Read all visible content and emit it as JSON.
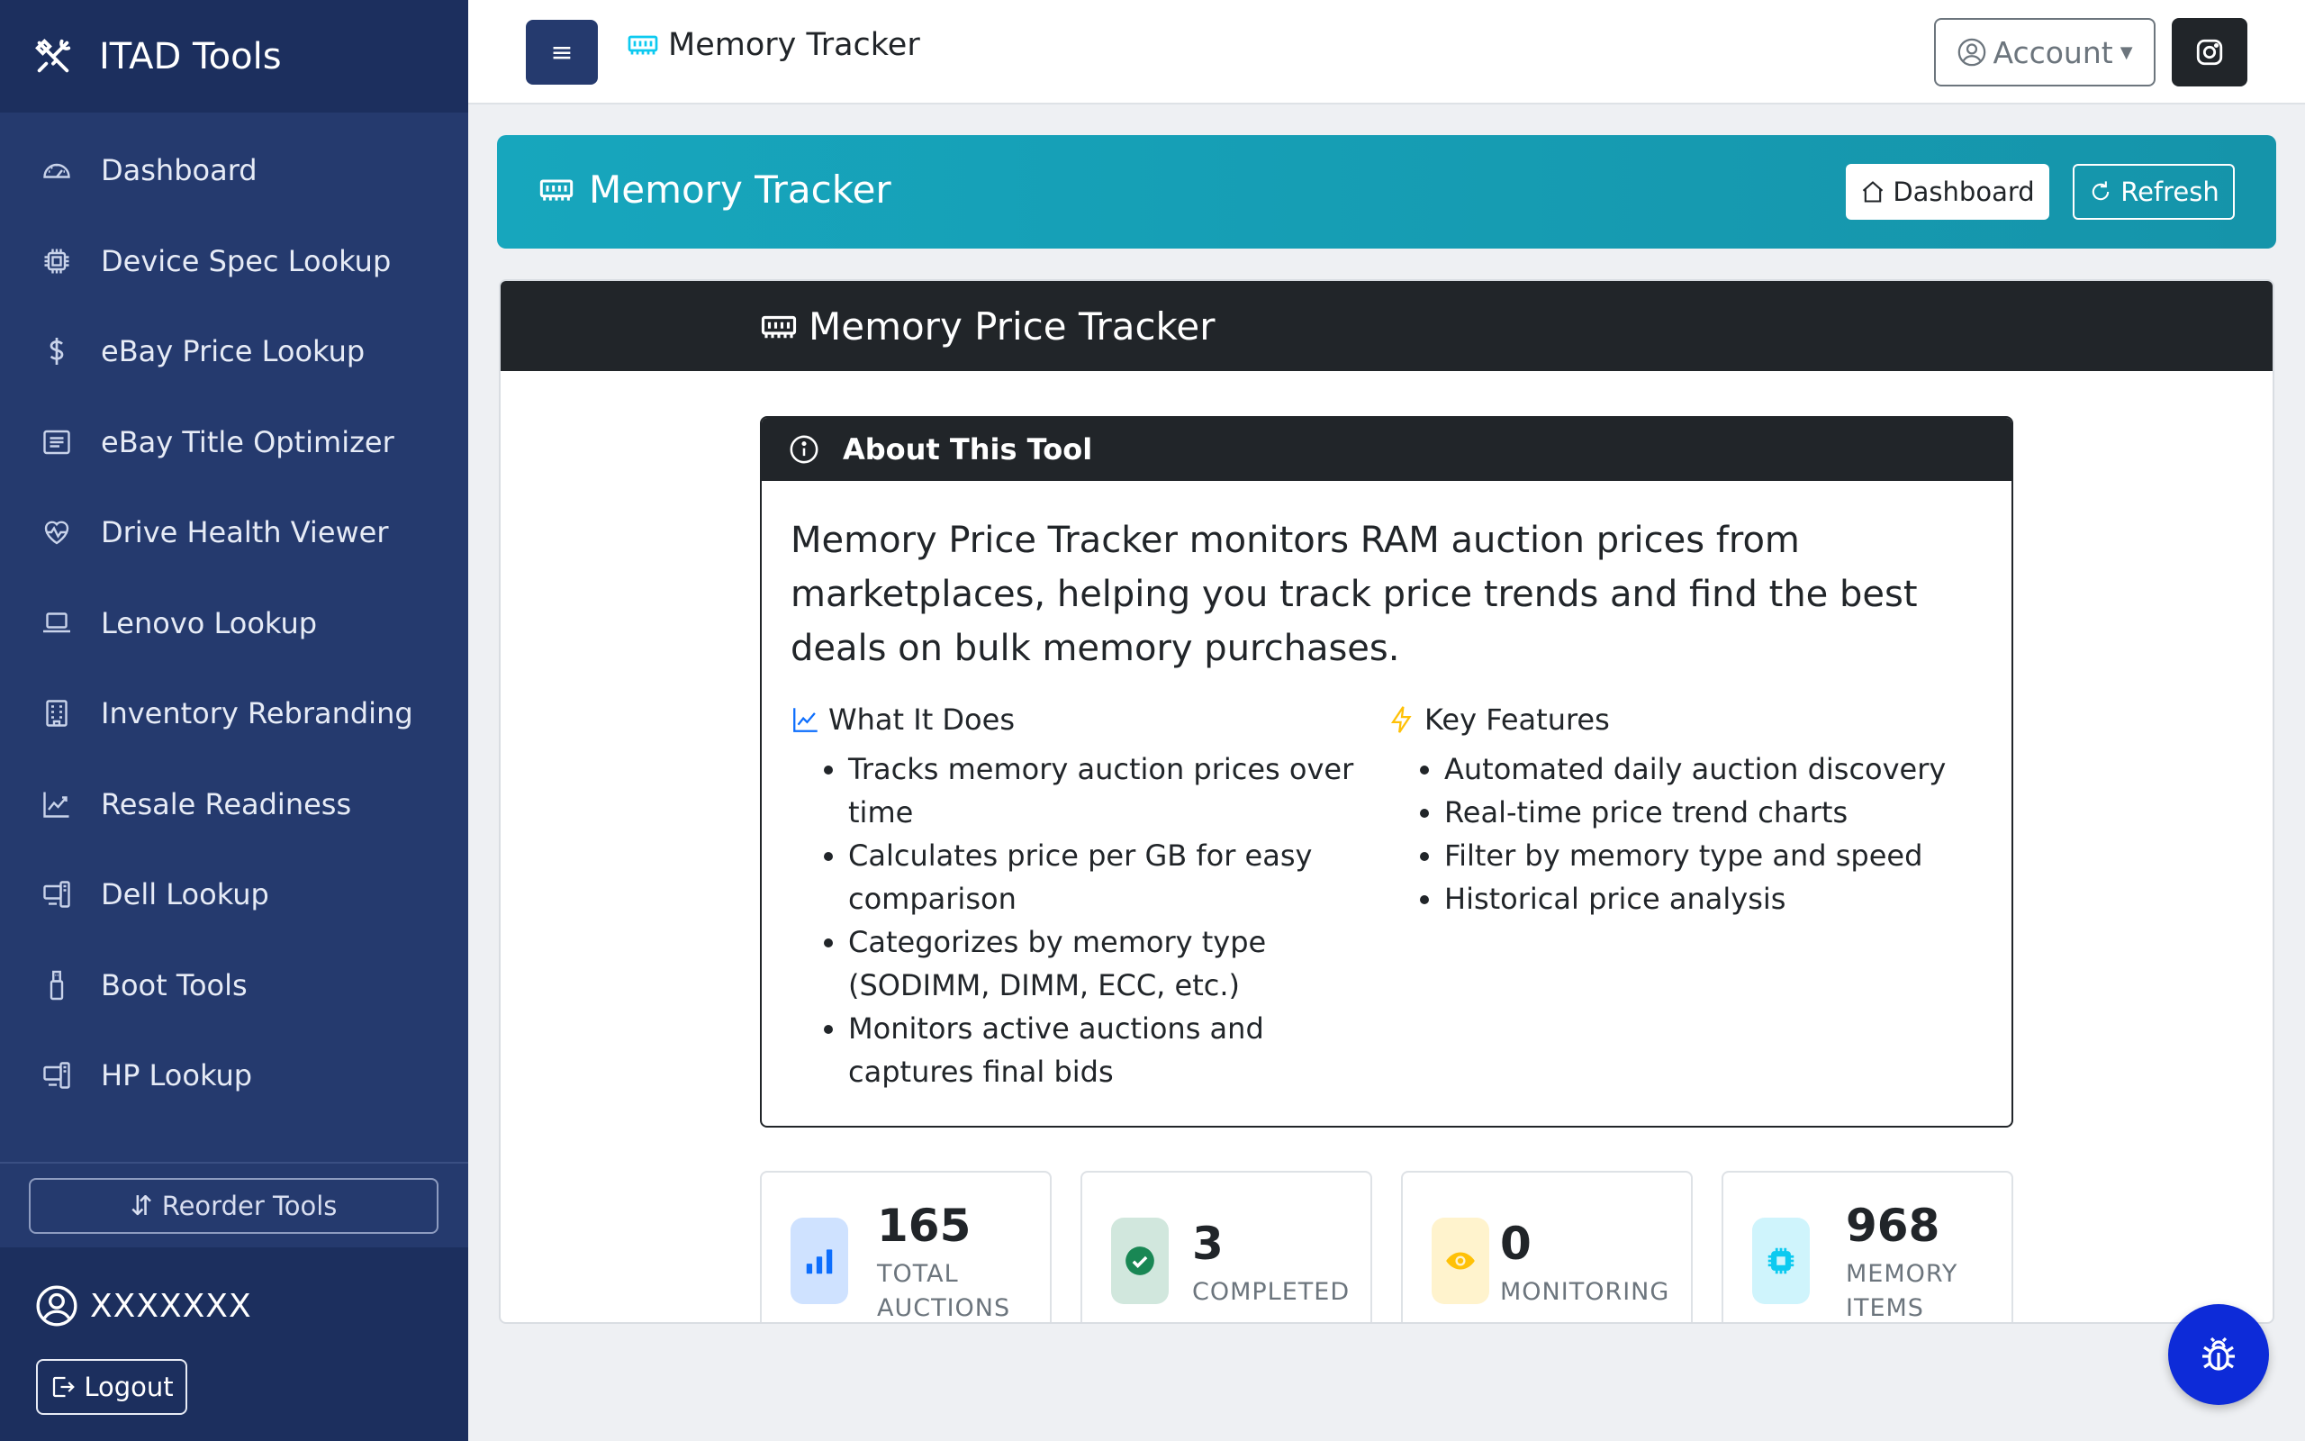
{
  "sidebar": {
    "brand": "ITAD Tools",
    "items": [
      {
        "label": "Dashboard",
        "icon": "speedometer-icon"
      },
      {
        "label": "Device Spec Lookup",
        "icon": "cpu-icon"
      },
      {
        "label": "eBay Price Lookup",
        "icon": "dollar-icon"
      },
      {
        "label": "eBay Title Optimizer",
        "icon": "card-text-icon"
      },
      {
        "label": "Drive Health Viewer",
        "icon": "heart-pulse-icon"
      },
      {
        "label": "Lenovo Lookup",
        "icon": "laptop-icon"
      },
      {
        "label": "Inventory Rebranding",
        "icon": "building-icon"
      },
      {
        "label": "Resale Readiness",
        "icon": "graph-up-icon"
      },
      {
        "label": "Dell Lookup",
        "icon": "devices-icon"
      },
      {
        "label": "Boot Tools",
        "icon": "usb-drive-icon"
      },
      {
        "label": "HP Lookup",
        "icon": "devices-icon"
      }
    ],
    "reorder_label": "Reorder Tools",
    "username": "XXXXXXX",
    "logout_label": "Logout"
  },
  "topbar": {
    "menu_glyph": "≡",
    "title": "Memory Tracker",
    "account_label": "Account"
  },
  "banner": {
    "title": "Memory Tracker",
    "dashboard_label": "Dashboard",
    "refresh_label": "Refresh"
  },
  "card": {
    "title": "Memory Price Tracker",
    "about": {
      "heading": "About This Tool",
      "description": "Memory Price Tracker monitors RAM auction prices from marketplaces, helping you track price trends and find the best deals on bulk memory purchases.",
      "what_it_does": {
        "heading": "What It Does",
        "items": [
          "Tracks memory auction prices over time",
          "Calculates price per GB for easy comparison",
          "Categorizes by memory type (SODIMM, DIMM, ECC, etc.)",
          "Monitors active auctions and captures final bids"
        ]
      },
      "key_features": {
        "heading": "Key Features",
        "items": [
          "Automated daily auction discovery",
          "Real-time price trend charts",
          "Filter by memory type and speed",
          "Historical price analysis"
        ]
      }
    },
    "stats": [
      {
        "value": "165",
        "label_line1": "TOTAL",
        "label_line2": "AUCTIONS",
        "color": "#0d6efd"
      },
      {
        "value": "3",
        "label_line1": "COMPLETED",
        "label_line2": "",
        "color": "#198754"
      },
      {
        "value": "0",
        "label_line1": "MONITORING",
        "label_line2": "",
        "color": "#ffc107"
      },
      {
        "value": "968",
        "label_line1": "MEMORY",
        "label_line2": "ITEMS",
        "color": "#0dcaf0"
      }
    ]
  },
  "colors": {
    "sidebar": "#253a6e",
    "banner": "#17a6bd",
    "fab": "#0d2bd8"
  }
}
